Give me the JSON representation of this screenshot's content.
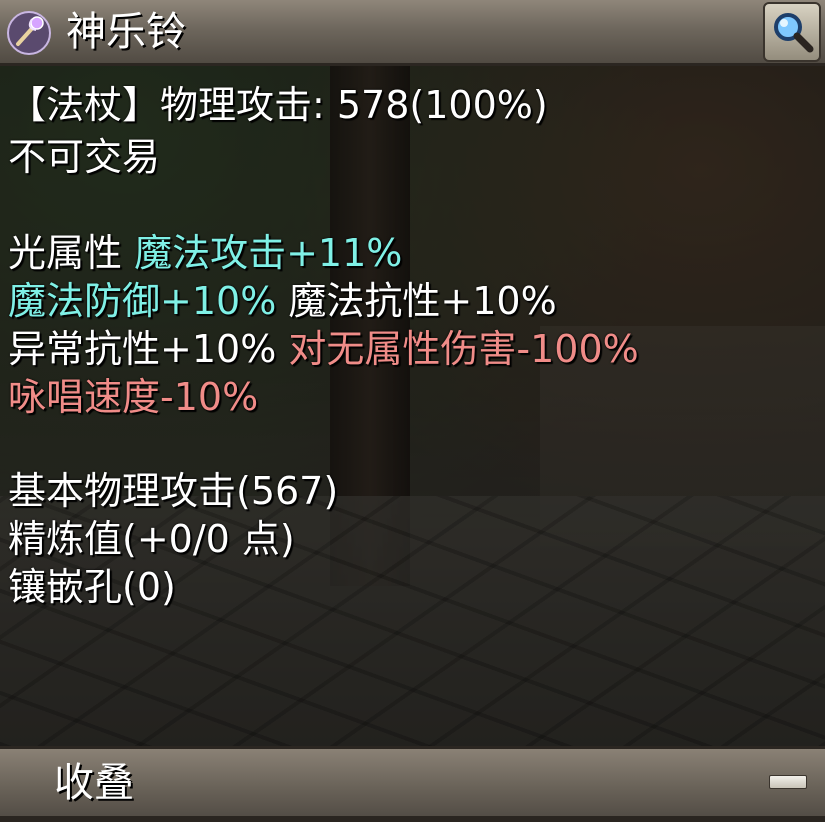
{
  "header": {
    "item_name": "神乐铃",
    "weapon_icon": "staff-icon",
    "search_icon": "magnifier-icon"
  },
  "stats": {
    "line1": "【法杖】物理攻击: 578(100%)",
    "line2": "不可交易",
    "line3_a": "光属性 ",
    "line3_b": "魔法攻击+11%",
    "line4_a": "魔法防御+10%",
    "line4_b": " 魔法抗性+10%",
    "line5_a": "异常抗性+10%",
    "line5_b": " 对无属性伤害-100%",
    "line6": "咏唱速度-10%",
    "line7": "基本物理攻击(567)",
    "line8": "精炼值(+0/0 点)",
    "line9": "镶嵌孔(0)"
  },
  "footer": {
    "collapse_label": "收叠",
    "collapse_icon": "minus-icon"
  },
  "colors": {
    "normal_text": "#ffffff",
    "buff_text": "#7ff0e6",
    "debuff_text": "#f08c88"
  }
}
